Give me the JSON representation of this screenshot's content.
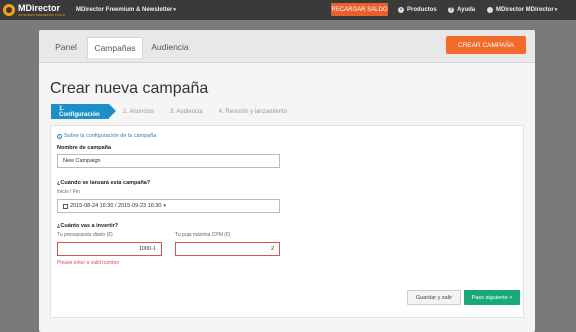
{
  "topbar": {
    "logo_name": "MDirector",
    "logo_sub": "ANTEVENIO MARKETING TOOLS",
    "account_label": "MDirector Freemium & Newsletter",
    "recharge_label": "RECARGAR SALDO",
    "products_label": "Productos",
    "help_label": "Ayuda",
    "user_label": "MDirector MDirector",
    "caret": "▾"
  },
  "tabs": [
    {
      "label": "Panel"
    },
    {
      "label": "Campañas"
    },
    {
      "label": "Audiencia"
    }
  ],
  "create_button": "CREAR CAMPAÑA",
  "page_title": "Crear nueva campaña",
  "steps": [
    {
      "label": "1. Configuración"
    },
    {
      "label": "2. Anuncios"
    },
    {
      "label": "3. Audiencia"
    },
    {
      "label": "4. Revisión y lanzamiento"
    }
  ],
  "form": {
    "info_link": "Sobre la configuración de la campaña",
    "name_label": "Nombre de campaña",
    "name_value": "New Campaign",
    "when_label": "¿Cuándo se lanzará esta campaña?",
    "when_sub": "Inicio / Fin",
    "date_range": "2015-08-24 16:30  /  2015-09-23 16:30",
    "invest_label": "¿Cuánto vas a invertir?",
    "budget_label": "Tu presupuesto diario (€)",
    "budget_value": "1000-1",
    "bid_label": "Tu puja máxima CPM (€)",
    "bid_value": "2",
    "error_msg": "Please enter a valid number",
    "save_button": "Guardar y salir",
    "next_button": "Paso siguiente >"
  }
}
